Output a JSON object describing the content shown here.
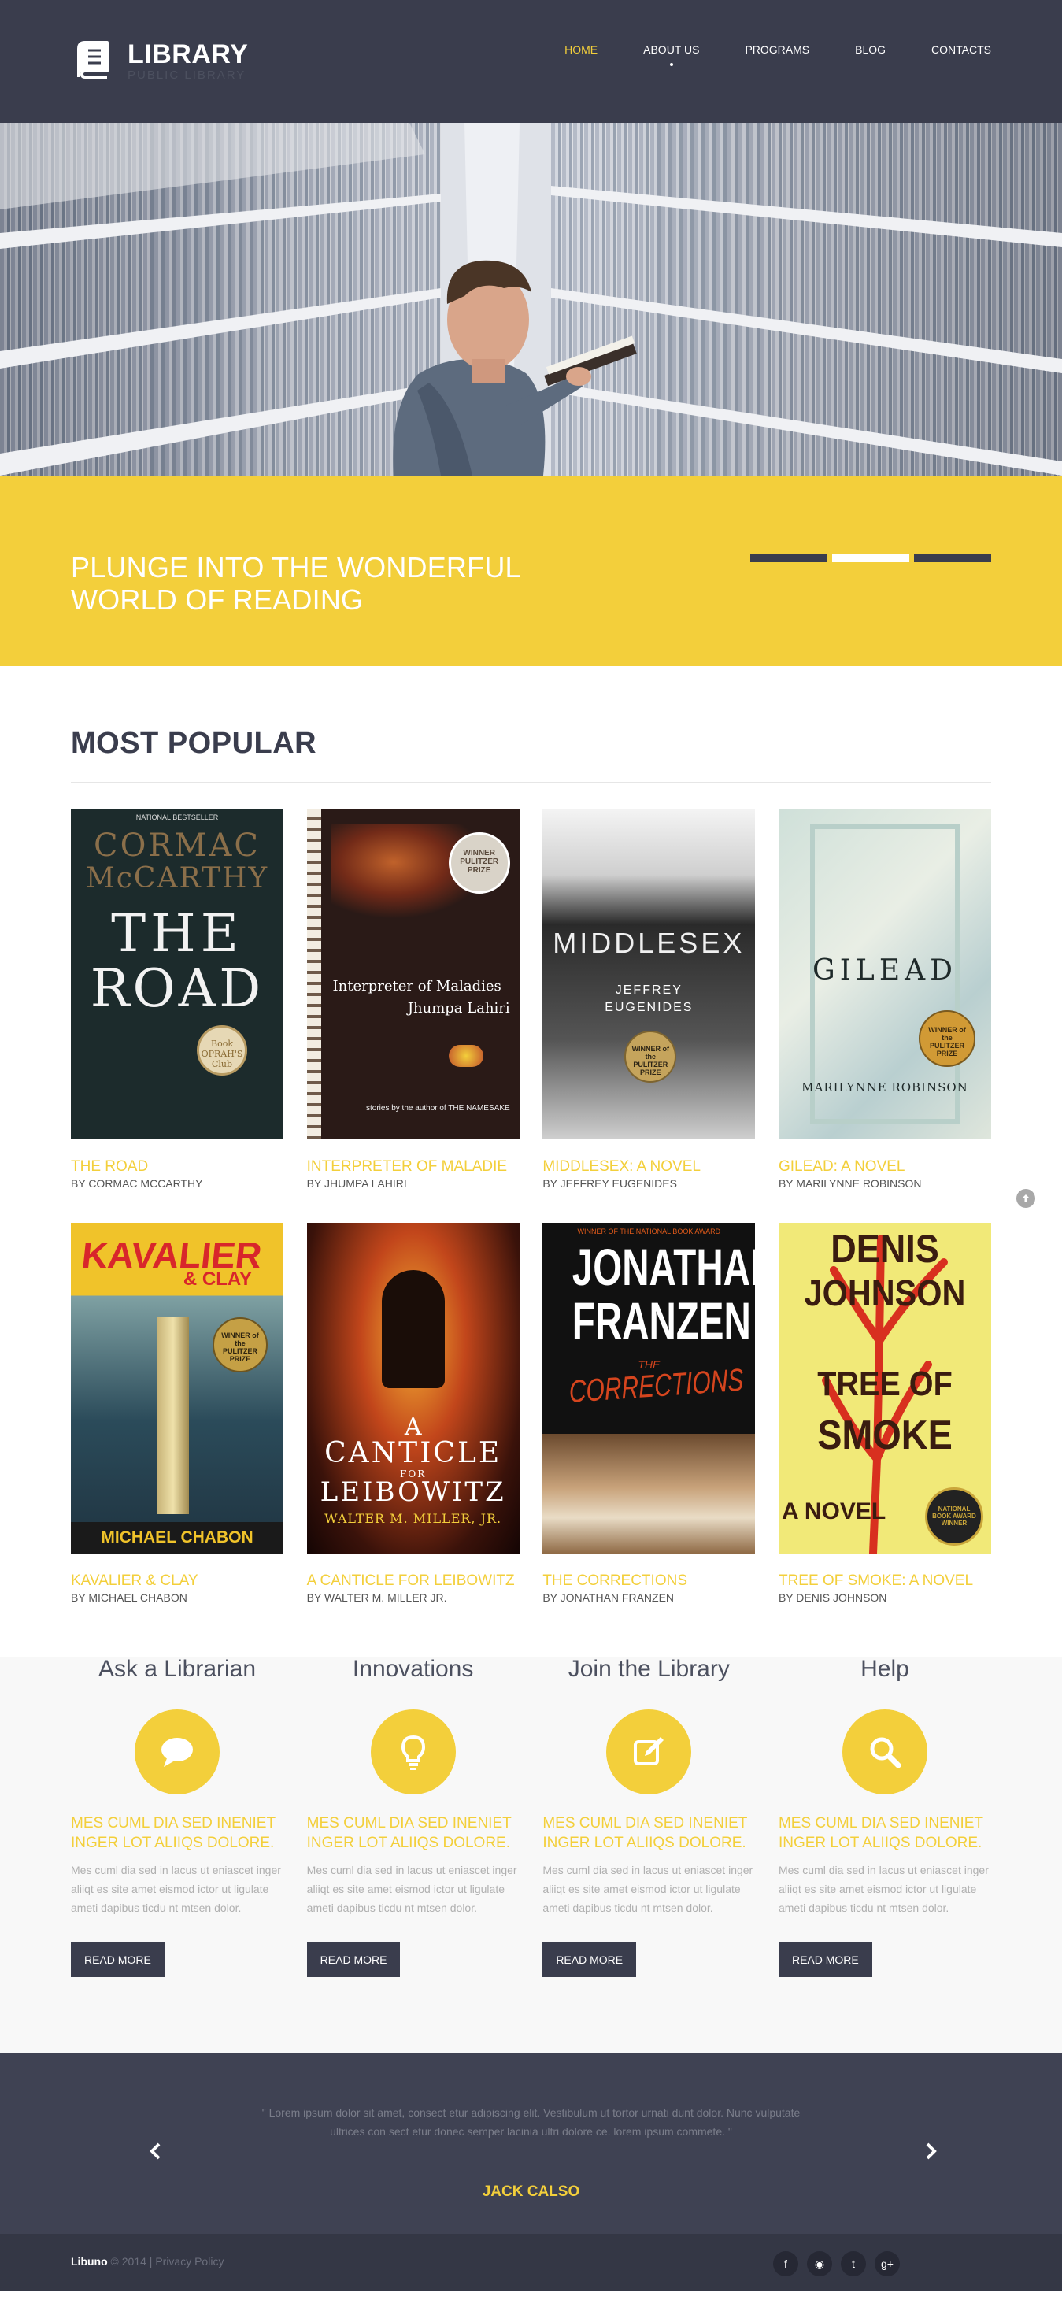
{
  "header": {
    "logo_title": "LIBRARY",
    "logo_subtitle": "PUBLIC LIBRARY",
    "nav": [
      {
        "label": "HOME",
        "active": true
      },
      {
        "label": "ABOUT US",
        "active": false
      },
      {
        "label": "PROGRAMS",
        "active": false
      },
      {
        "label": "BLOG",
        "active": false
      },
      {
        "label": "CONTACTS",
        "active": false
      }
    ]
  },
  "banner": {
    "line1": "PLUNGE INTO THE WONDERFUL",
    "line2": "WORLD OF READING",
    "slides": 3,
    "active_slide": 2
  },
  "popular": {
    "title": "MOST POPULAR",
    "books": [
      {
        "title": "THE ROAD",
        "author": "BY CORMAC MCCARTHY"
      },
      {
        "title": "INTERPRETER OF MALADIE",
        "author": "BY JHUMPA LAHIRI"
      },
      {
        "title": "MIDDLESEX: A NOVEL",
        "author": "BY JEFFREY EUGENIDES"
      },
      {
        "title": "GILEAD: A NOVEL",
        "author": "BY MARILYNNE ROBINSON"
      },
      {
        "title": "KAVALIER & CLAY",
        "author": "BY MICHAEL CHABON"
      },
      {
        "title": "A CANTICLE FOR LEIBOWITZ",
        "author": "BY WALTER M. MILLER JR."
      },
      {
        "title": "THE CORRECTIONS",
        "author": "BY JONATHAN FRANZEN"
      },
      {
        "title": "TREE OF SMOKE: A NOVEL",
        "author": "BY DENIS JOHNSON"
      }
    ]
  },
  "covers": {
    "road": {
      "top": "NATIONAL BESTSELLER",
      "author1": "CORMAC",
      "author2": "McCARTHY",
      "title1": "THE",
      "title2": "ROAD",
      "seal": "Book OPRAH'S Club"
    },
    "maladies": {
      "title": "Interpreter of Maladies",
      "author": "Jhumpa Lahiri",
      "seal": "WINNER PULITZER PRIZE",
      "foot": "stories by the author of THE NAMESAKE"
    },
    "middlesex": {
      "title": "MIDDLESEX",
      "author1": "JEFFREY",
      "author2": "EUGENIDES",
      "seal": "WINNER of the PULITZER PRIZE"
    },
    "gilead": {
      "title": "GILEAD",
      "author": "MARILYNNE ROBINSON",
      "seal": "WINNER of the PULITZER PRIZE"
    },
    "kavalier": {
      "title1": "KAVALIER",
      "title2": "& CLAY",
      "author": "MICHAEL CHABON",
      "seal": "WINNER of the PULITZER PRIZE"
    },
    "canticle": {
      "title1": "A",
      "title2": "CANTICLE",
      "title3": "FOR",
      "title4": "LEIBOWITZ",
      "author": "WALTER M. MILLER, JR."
    },
    "corrections": {
      "top": "WINNER OF THE NATIONAL BOOK AWARD",
      "author1": "JONATHAN",
      "author2": "FRANZEN",
      "title1": "THE",
      "title2": "CORRECTIONS"
    },
    "smoke": {
      "author1": "DENIS",
      "author2": "JOHNSON",
      "title1": "TREE OF",
      "title2": "SMOKE",
      "foot": "A NOVEL",
      "seal": "NATIONAL BOOK AWARD WINNER"
    }
  },
  "features": [
    {
      "heading": "Ask a Librarian",
      "icon": "speech-bubble-icon",
      "subtitle": "MES CUML DIA SED INENIET INGER LOT ALIIQS DOLORE.",
      "body": "Mes cuml dia sed in lacus ut eniascet inger aliiqt es site amet eismod ictor ut ligulate ameti dapibus ticdu nt mtsen dolor.",
      "button": "READ MORE"
    },
    {
      "heading": "Innovations",
      "icon": "lightbulb-icon",
      "subtitle": "MES CUML DIA SED INENIET INGER LOT ALIIQS DOLORE.",
      "body": "Mes cuml dia sed in lacus ut eniascet inger aliiqt es site amet eismod ictor ut ligulate ameti dapibus ticdu nt mtsen dolor.",
      "button": "READ MORE"
    },
    {
      "heading": "Join the Library",
      "icon": "edit-icon",
      "subtitle": "MES CUML DIA SED INENIET INGER LOT ALIIQS DOLORE.",
      "body": "Mes cuml dia sed in lacus ut eniascet inger aliiqt es site amet eismod ictor ut ligulate ameti dapibus ticdu nt mtsen dolor.",
      "button": "READ MORE"
    },
    {
      "heading": "Help",
      "icon": "search-icon",
      "subtitle": "MES CUML DIA SED INENIET INGER LOT ALIIQS DOLORE.",
      "body": "Mes cuml dia sed in lacus ut eniascet inger aliiqt es site amet eismod ictor ut ligulate ameti dapibus ticdu nt mtsen dolor.",
      "button": "READ MORE"
    }
  ],
  "testimonial": {
    "quote": "\" Lorem ipsum dolor sit amet, consect etur adipiscing elit. Vestibulum ut tortor urnati dunt dolor. Nunc vulputate ultrices con sect etur donec semper lacinia ultri dolore ce. lorem ipsum commete. \"",
    "author": "JACK CALSO"
  },
  "footer": {
    "brand": "Libuno",
    "copyright": " © 2014 | ",
    "privacy": "Privacy Policy",
    "socials": [
      {
        "icon": "facebook-icon",
        "glyph": "f"
      },
      {
        "icon": "rss-icon",
        "glyph": "◉"
      },
      {
        "icon": "twitter-icon",
        "glyph": "t"
      },
      {
        "icon": "google-plus-icon",
        "glyph": "g+"
      }
    ]
  },
  "colors": {
    "accent": "#f3cf3b",
    "dark": "#3a3d4d",
    "footer": "#343745"
  }
}
